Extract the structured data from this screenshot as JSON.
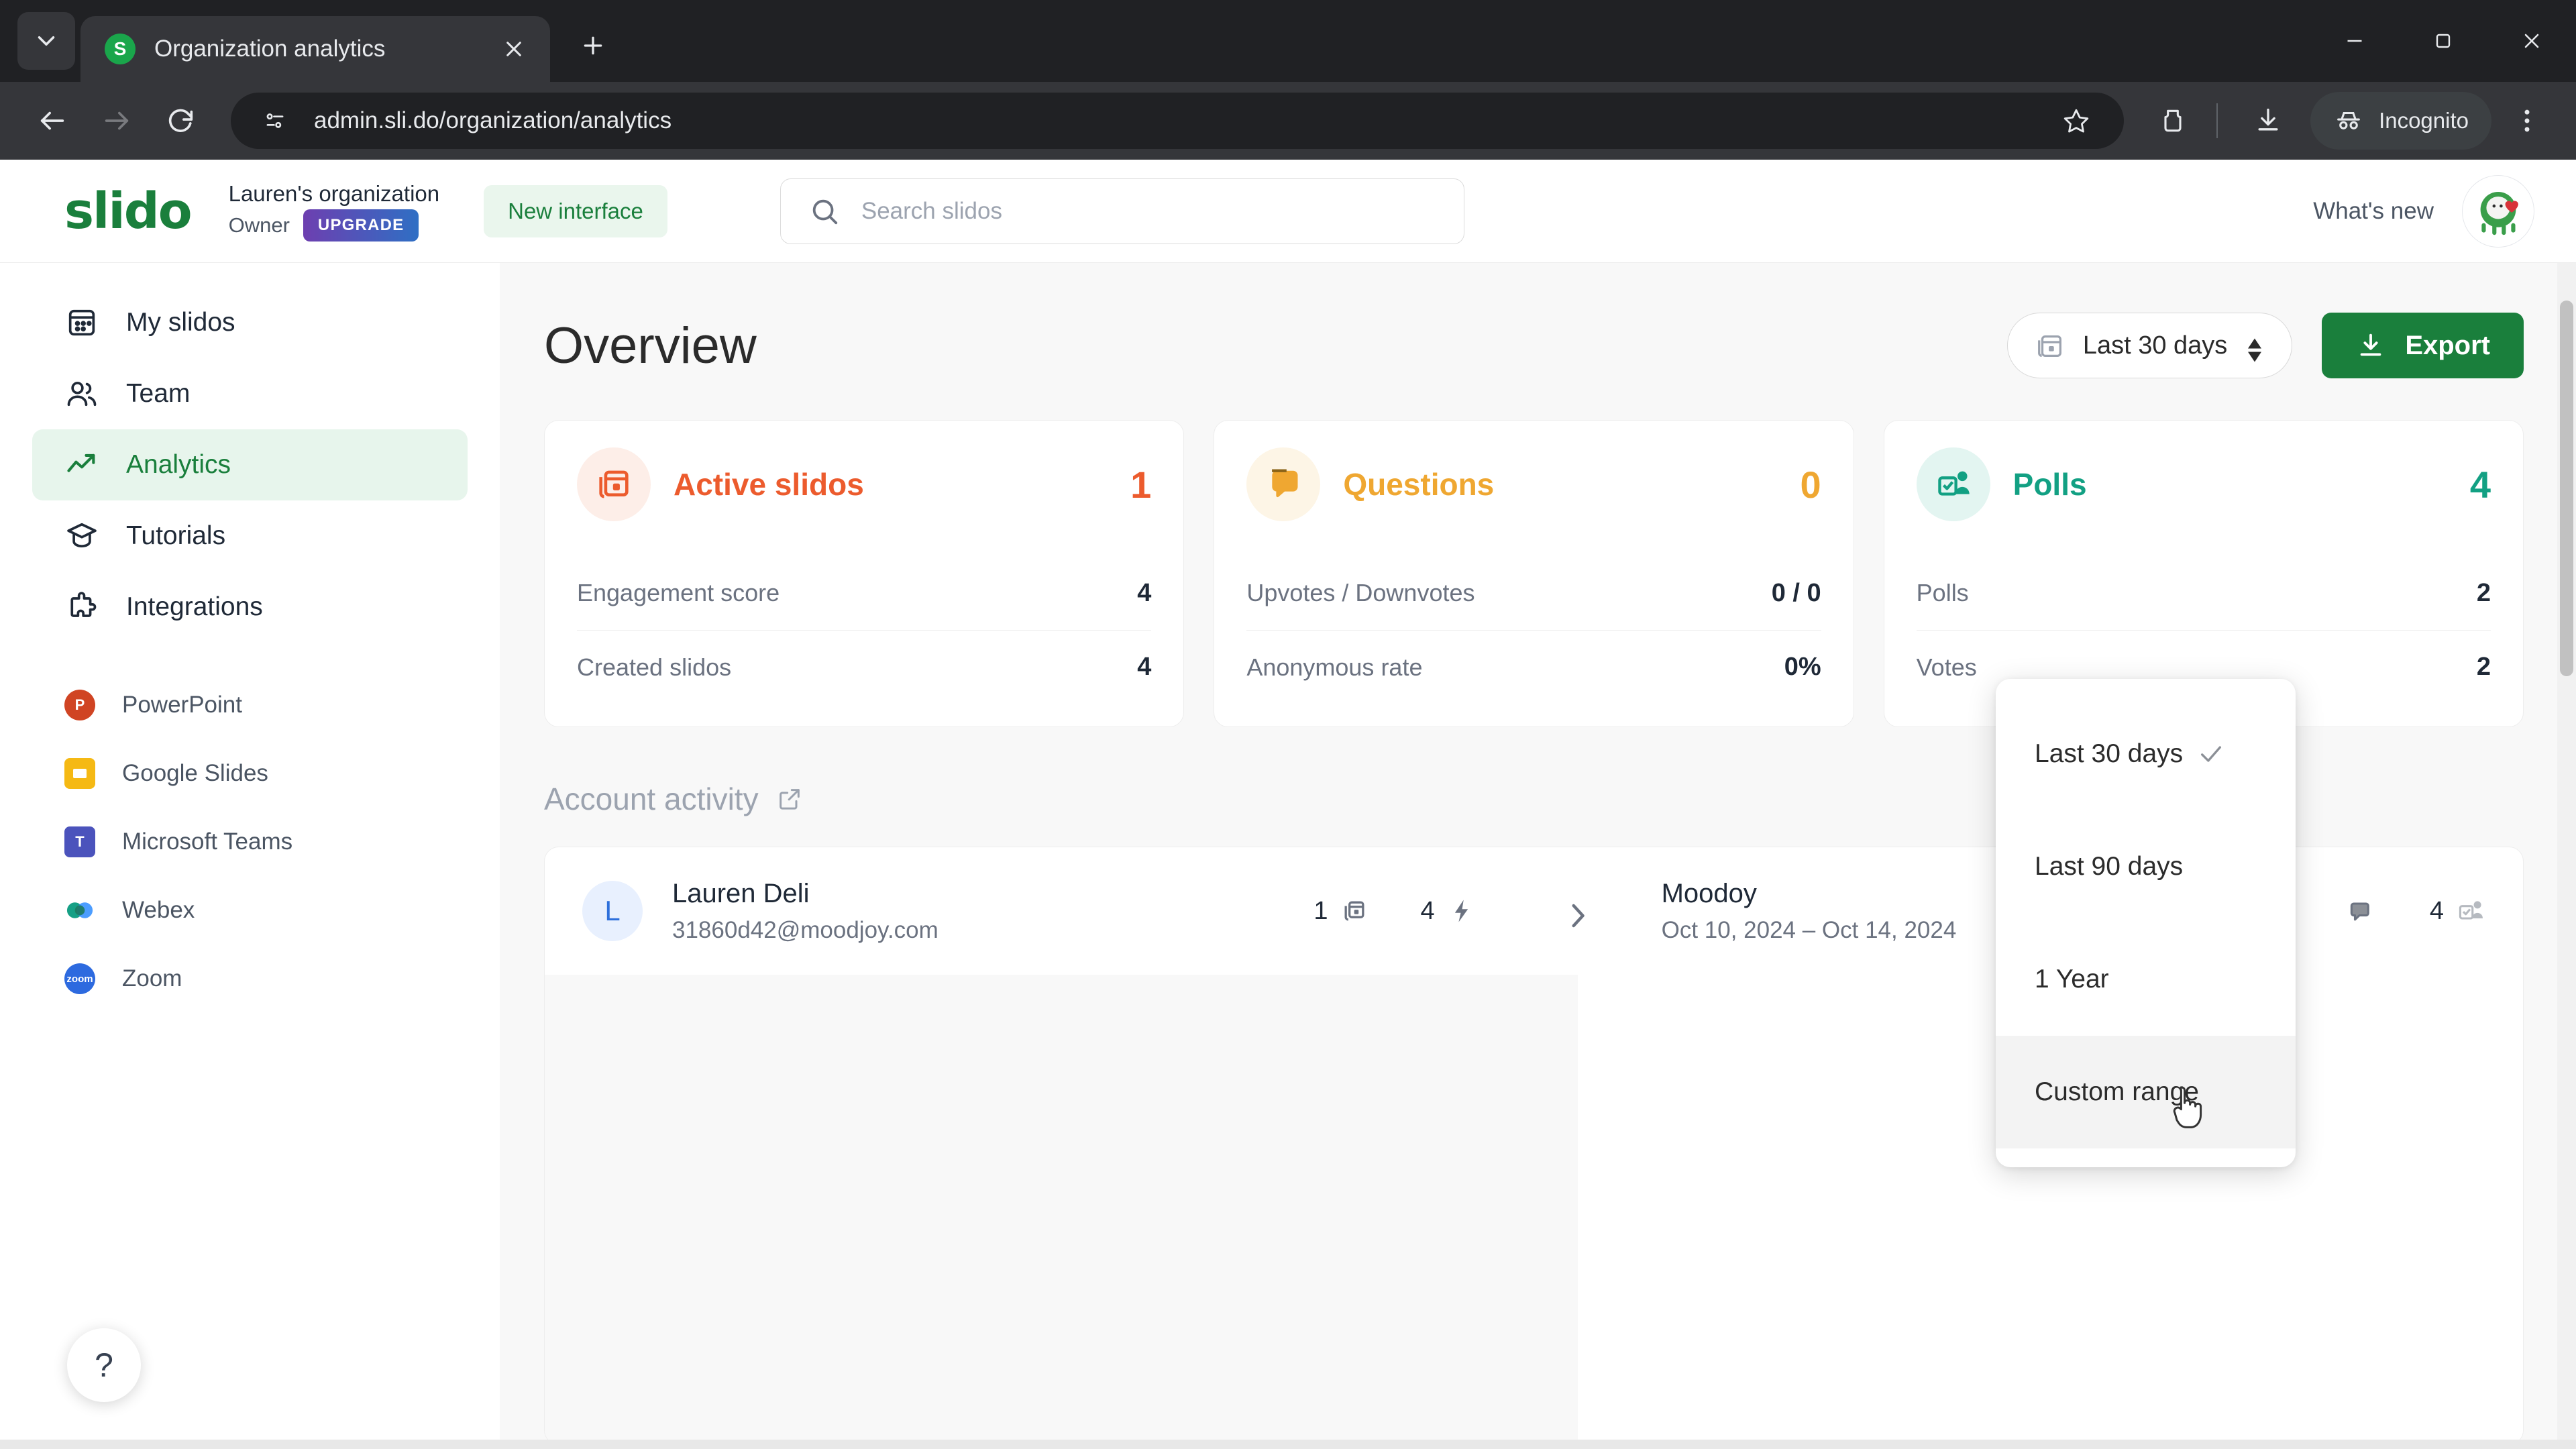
{
  "browser": {
    "tab": {
      "title": "Organization analytics",
      "favicon_letter": "S",
      "favicon_name": "slido-favicon"
    },
    "new_tab_label": "+",
    "omnibox": {
      "url": "admin.sli.do/organization/analytics"
    },
    "incognito_label": "Incognito",
    "icons": {
      "tab_search": "tab-search-icon",
      "close_tab": "close-icon",
      "back": "back-arrow-icon",
      "forward": "forward-arrow-icon",
      "reload": "reload-icon",
      "site_info": "site-settings-icon",
      "bookmark": "star-icon",
      "extensions": "extensions-icon",
      "downloads": "download-icon",
      "incognito": "incognito-icon",
      "menu": "three-dot-menu-icon",
      "minimize": "minimize-icon",
      "maximize": "maximize-icon",
      "close_window": "window-close-icon"
    }
  },
  "app_header": {
    "logo": "slido",
    "organization": "Lauren's organization",
    "role": "Owner",
    "upgrade_badge": "UPGRADE",
    "new_interface": "New interface",
    "search_placeholder": "Search slidos",
    "whats_new": "What's new",
    "avatar_name": "user-avatar"
  },
  "sidebar": {
    "items": [
      {
        "label": "My slidos",
        "icon": "slides-icon",
        "active": false
      },
      {
        "label": "Team",
        "icon": "people-icon",
        "active": false
      },
      {
        "label": "Analytics",
        "icon": "trending-up-icon",
        "active": true
      },
      {
        "label": "Tutorials",
        "icon": "graduation-cap-icon",
        "active": false
      },
      {
        "label": "Integrations",
        "icon": "puzzle-piece-icon",
        "active": false
      }
    ],
    "integrations": [
      {
        "label": "PowerPoint",
        "icon": "powerpoint-icon",
        "color": "#d04423",
        "glyph": "P"
      },
      {
        "label": "Google Slides",
        "icon": "google-slides-icon",
        "color": "#f5b914",
        "glyph": ""
      },
      {
        "label": "Microsoft Teams",
        "icon": "microsoft-teams-icon",
        "color": "#4b53bc",
        "glyph": "T"
      },
      {
        "label": "Webex",
        "icon": "webex-icon",
        "color": "#2eb3a6",
        "glyph": ""
      },
      {
        "label": "Zoom",
        "icon": "zoom-icon",
        "color": "#2d8cff",
        "glyph": ""
      }
    ],
    "help_label": "?"
  },
  "main": {
    "title": "Overview",
    "range_selector": {
      "value": "Last 30 days",
      "icon": "calendar-icon"
    },
    "export_label": "Export",
    "cards": [
      {
        "title": "Active slidos",
        "value": "1",
        "color": "#ec5b2d",
        "bg": "#fdeee8",
        "icon": "active-slidos-icon",
        "rows": [
          {
            "key": "Engagement score",
            "value": "4"
          },
          {
            "key": "Created slidos",
            "value": "4"
          }
        ]
      },
      {
        "title": "Questions",
        "value": "0",
        "color": "#efa731",
        "bg": "#fdf5e6",
        "icon": "questions-icon",
        "rows": [
          {
            "key": "Upvotes / Downvotes",
            "value": "0 / 0"
          },
          {
            "key": "Anonymous rate",
            "value": "0%"
          }
        ]
      },
      {
        "title": "Polls",
        "value": "4",
        "color": "#12a083",
        "bg": "#e3f5f1",
        "icon": "polls-icon",
        "rows": [
          {
            "key": "Polls",
            "value": "2"
          },
          {
            "key": "Votes",
            "value": "2"
          }
        ]
      }
    ],
    "account_activity": {
      "title": "Account activity",
      "icon": "external-link-icon"
    },
    "activity_row": {
      "avatar_letter": "L",
      "user_name": "Lauren Deli",
      "user_email": "31860d42@moodjoy.com",
      "user_metrics": [
        {
          "value": "1",
          "icon": "slidos-count-icon"
        },
        {
          "value": "4",
          "icon": "engagement-bolt-icon"
        }
      ],
      "expand_icon": "chevron-right-icon",
      "event_name": "Moodoy",
      "event_dates": "Oct 10, 2024 – Oct 14, 2024",
      "event_metrics": [
        {
          "value": "",
          "icon": "questions-bubble-icon"
        },
        {
          "value": "4",
          "icon": "polls-small-icon"
        }
      ]
    }
  },
  "dropdown": {
    "open": true,
    "items": [
      {
        "label": "Last 30 days",
        "selected": true,
        "hovered": false
      },
      {
        "label": "Last 90 days",
        "selected": false,
        "hovered": false
      },
      {
        "label": "1 Year",
        "selected": false,
        "hovered": false
      },
      {
        "label": "Custom range",
        "selected": false,
        "hovered": true
      }
    ],
    "check_icon": "check-icon"
  },
  "colors": {
    "brand_green": "#1a7f3c",
    "accent_orange": "#ec5b2d",
    "accent_yellow": "#efa731",
    "accent_teal": "#12a083",
    "chrome_dark": "#202124"
  }
}
